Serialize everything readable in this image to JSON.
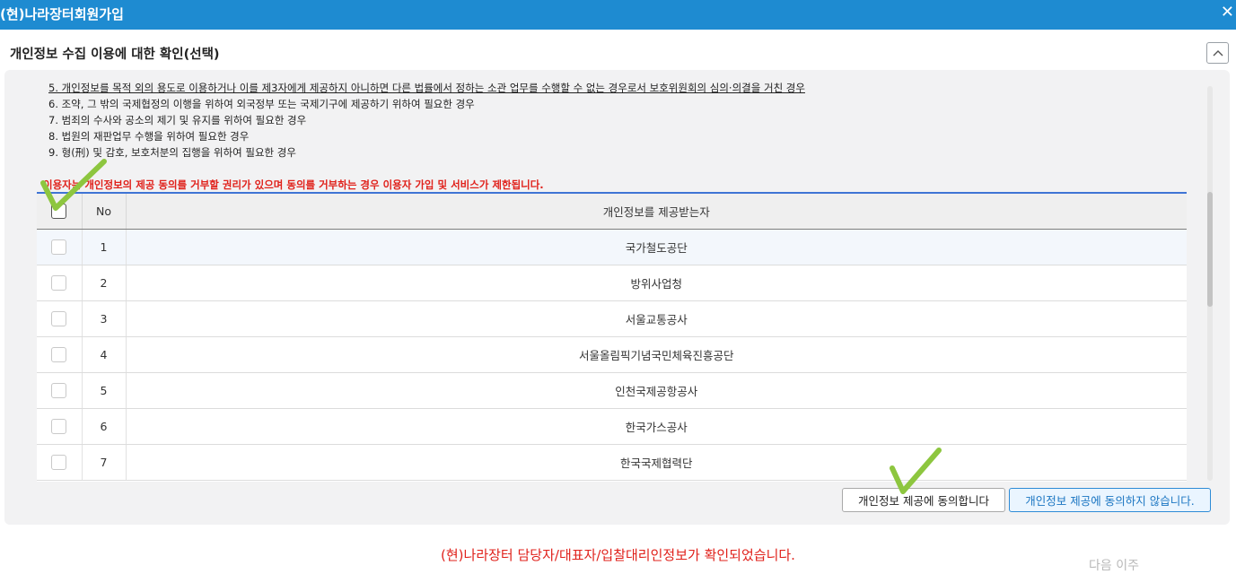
{
  "window": {
    "title": "(현)나라장터회원가입",
    "close_label": "✕"
  },
  "section": {
    "title": "개인정보 수집 이용에 대한 확인(선택)",
    "collapse_icon": "chevron-up-icon"
  },
  "notices": [
    "5. 개인정보를 목적 외의 용도로 이용하거나 이를 제3자에게 제공하지 아니하면 다른 법률에서 정하는 소관 업무를 수행할 수 없는 경우로서 보호위원회의 심의·의결을 거친 경우",
    "6. 조약, 그 밖의 국제협정의 이행을 위하여 외국정부 또는 국제기구에 제공하기 위하여 필요한 경우",
    "7. 범죄의 수사와 공소의 제기 및 유지를 위하여 필요한 경우",
    "8. 법원의 재판업무 수행을 위하여 필요한 경우",
    "9. 형(刑) 및 감호, 보호처분의 집행을 위하여 필요한 경우"
  ],
  "warning": "이용자는 개인정보의 제공 동의를 거부할 권리가 있으며 동의를 거부하는 경우 이용자 가입 및 서비스가 제한됩니다.",
  "grid": {
    "headers": {
      "no": "No",
      "recipient": "개인정보를 제공받는자"
    },
    "rows": [
      {
        "no": "1",
        "name": "국가철도공단"
      },
      {
        "no": "2",
        "name": "방위사업청"
      },
      {
        "no": "3",
        "name": "서울교통공사"
      },
      {
        "no": "4",
        "name": "서울올림픽기념국민체육진흥공단"
      },
      {
        "no": "5",
        "name": "인천국제공항공사"
      },
      {
        "no": "6",
        "name": "한국가스공사"
      },
      {
        "no": "7",
        "name": "한국국제협력단"
      }
    ]
  },
  "buttons": {
    "agree": "개인정보 제공에 동의합니다",
    "disagree": "개인정보 제공에 동의하지 않습니다."
  },
  "confirm_message": "(현)나라장터 담당자/대표자/입찰대리인정보가 확인되었습니다.",
  "faded_text": "다음 이주",
  "colors": {
    "title_bar": "#1e8bd1",
    "warning_red": "#e0211b",
    "annotation_green": "#8dc63f"
  }
}
